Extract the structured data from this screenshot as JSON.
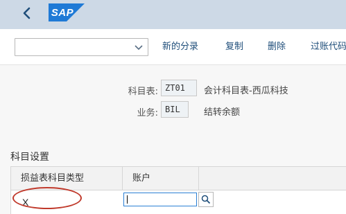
{
  "shell": {
    "back_icon": "chevron-left-icon",
    "logo_text": "SAP",
    "colors": {
      "header_bg": "#cdd9e6",
      "logo_blue": "#1f7ad6"
    }
  },
  "toolbar": {
    "variant_select_value": "",
    "buttons": {
      "new_entries": "新的分录",
      "copy": "复制",
      "delete": "删除",
      "posting_code": "过账代码"
    }
  },
  "header": {
    "chart_of_accounts_label": "科目表:",
    "chart_of_accounts_value": "ZT01",
    "chart_of_accounts_desc": "会计科目表-西瓜科技",
    "transaction_label": "业务:",
    "transaction_value": "BIL",
    "transaction_desc": "结转余额"
  },
  "section": {
    "title": "科目设置"
  },
  "table": {
    "columns": [
      "损益表科目类型",
      "账户"
    ],
    "rows": [
      {
        "pl_account_type": "X",
        "account": ""
      }
    ]
  },
  "annotation": {
    "highlight_color": "#c0392b"
  }
}
